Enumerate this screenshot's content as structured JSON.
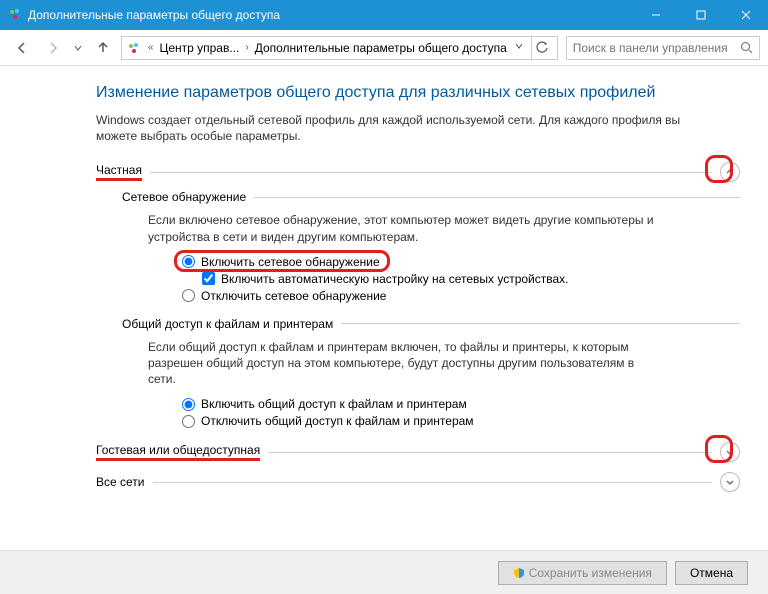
{
  "window": {
    "title": "Дополнительные параметры общего доступа"
  },
  "breadcrumb": {
    "seg1": "Центр управ...",
    "seg2": "Дополнительные параметры общего доступа"
  },
  "search": {
    "placeholder": "Поиск в панели управления"
  },
  "page": {
    "heading": "Изменение параметров общего доступа для различных сетевых профилей",
    "subheading": "Windows создает отдельный сетевой профиль для каждой используемой сети. Для каждого профиля вы можете выбрать особые параметры."
  },
  "sections": {
    "private": {
      "label": "Частная",
      "discovery": {
        "title": "Сетевое обнаружение",
        "desc": "Если включено сетевое обнаружение, этот компьютер может видеть другие компьютеры и устройства в сети и виден другим компьютерам.",
        "radio_on": "Включить сетевое обнаружение",
        "checkbox_auto": "Включить автоматическую настройку на сетевых устройствах.",
        "radio_off": "Отключить сетевое обнаружение"
      },
      "fileshare": {
        "title": "Общий доступ к файлам и принтерам",
        "desc": "Если общий доступ к файлам и принтерам включен, то файлы и принтеры, к которым разрешен общий доступ на этом компьютере, будут доступны другим пользователям в сети.",
        "radio_on": "Включить общий доступ к файлам и принтерам",
        "radio_off": "Отключить общий доступ к файлам и принтерам"
      }
    },
    "guest": {
      "label": "Гостевая или общедоступная"
    },
    "all": {
      "label": "Все сети"
    }
  },
  "buttons": {
    "save": "Сохранить изменения",
    "cancel": "Отмена"
  }
}
